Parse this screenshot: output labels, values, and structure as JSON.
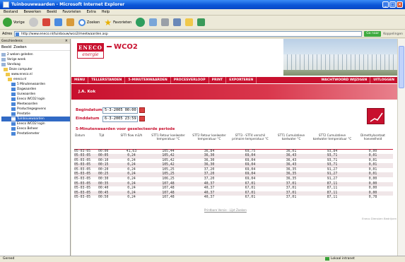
{
  "window": {
    "title": "Tuinbouwwaarden - Microsoft Internet Explorer"
  },
  "menu": [
    "Bestand",
    "Bewerken",
    "Beeld",
    "Favorieten",
    "Extra",
    "Help"
  ],
  "toolbar": {
    "back": "Vorige",
    "search": "Zoeken",
    "favorites": "Favorieten"
  },
  "address": {
    "label": "Adres",
    "url": "http://www.eneco.nl/tuinbouw/wco2/meetwaarden.asp",
    "go": "Ga naar",
    "links": "Koppelingen"
  },
  "sidebar": {
    "title": "Geschiedenis",
    "view": "Beeld",
    "search": "Zoeken",
    "items": [
      "2 weken geleden",
      "Vorige week",
      "Vandaag",
      "Deze computer",
      "www.eneco.nl",
      "eneco.nl",
      "5 Minutenwaarden",
      "Dagwaarden",
      "Uurwaarden",
      "Eneco WCO2 login",
      "Meetwaarden",
      "Productiegegevens",
      "Prestatie",
      "Tuinbouwwaarden",
      "Eneco WCO2 login",
      "Eneco Beheer",
      "Prestatiemeter"
    ]
  },
  "header": {
    "logo_top": "ENECO",
    "logo_bottom": "energie",
    "product": "WCO2"
  },
  "nav": {
    "left": [
      "MENU",
      "TELLERSTANDEN",
      "5-MINUTENWAARDEN",
      "PROCESVERLOOP",
      "PRINT",
      "EXPORTEREN"
    ],
    "right": [
      "WACHTWOORD WIJZIGEN",
      "UITLOGGEN"
    ]
  },
  "subheader": "J.A. Kok",
  "form": {
    "begin_label": "Begindatum",
    "begin_value": "5-3-2005 00:00",
    "end_label": "Einddatum",
    "end_value": "6-3-2005 23:59"
  },
  "section_title": "5-Minutenwaarden voor geselecteerde periode",
  "table": {
    "headers": [
      "Datum",
      "Tijd",
      "SFTI flow m3/h",
      "STT1 Retour koelwater temperatuur °C",
      "STT2 Retour koelwater temperatuur °C",
      "STT3 - STT4 verschil primaire temperatuur °C",
      "STT1 Cumulatieve koelwater °C",
      "STT2 Cumulatieve koelwater temperatuur °C",
      "Dimethylacetaat hoeveelheid"
    ],
    "rows": [
      [
        "05-03-05",
        "00:00",
        "41,63",
        "105,44",
        "36,84",
        "69,75",
        "36,01",
        "93,84",
        "0,00"
      ],
      [
        "05-03-05",
        "00:05",
        "0,24",
        "105,42",
        "36,30",
        "69,04",
        "36,43",
        "93,71",
        "0,01"
      ],
      [
        "05-03-05",
        "00:10",
        "0,24",
        "105,42",
        "36,30",
        "69,04",
        "36,43",
        "93,71",
        "0,01"
      ],
      [
        "05-03-05",
        "00:15",
        "0,24",
        "105,42",
        "36,30",
        "69,04",
        "36,43",
        "93,71",
        "0,01"
      ],
      [
        "05-03-05",
        "00:20",
        "0,24",
        "105,25",
        "37,20",
        "69,04",
        "36,35",
        "91,27",
        "0,01"
      ],
      [
        "05-03-05",
        "00:25",
        "0,24",
        "105,25",
        "37,20",
        "69,04",
        "36,35",
        "91,27",
        "0,01"
      ],
      [
        "05-03-05",
        "00:30",
        "0,24",
        "106,25",
        "37,20",
        "69,04",
        "36,35",
        "91,27",
        "0,00"
      ],
      [
        "05-03-05",
        "00:35",
        "0,24",
        "107,48",
        "40,37",
        "67,01",
        "37,01",
        "87,11",
        "0,00"
      ],
      [
        "05-03-05",
        "00:40",
        "0,24",
        "107,48",
        "40,37",
        "67,01",
        "37,01",
        "87,11",
        "0,00"
      ],
      [
        "05-03-05",
        "00:45",
        "0,24",
        "107,48",
        "40,37",
        "67,01",
        "37,01",
        "87,11",
        "0,00"
      ],
      [
        "05-03-05",
        "00:50",
        "0,24",
        "107,48",
        "40,37",
        "67,01",
        "37,01",
        "87,11",
        "0,78"
      ]
    ]
  },
  "footer_link": "Printbare Versie - Lijst Zoeken",
  "copyright": "Eneco Diensten Bedrijven",
  "status": {
    "left": "Gereed",
    "zone": "Lokaal intranet"
  }
}
